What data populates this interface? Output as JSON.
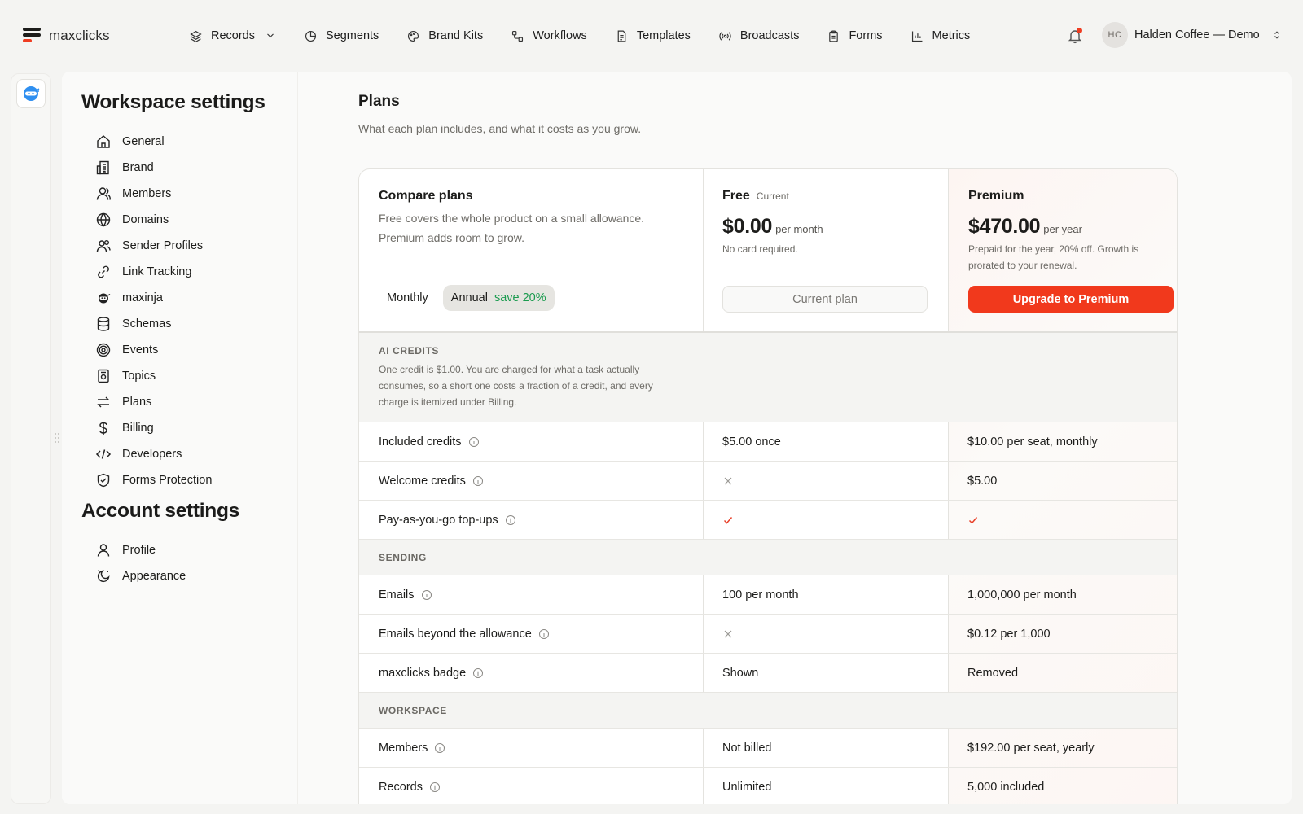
{
  "brand": {
    "name": "maxclicks",
    "colors": {
      "accent": "#f1391c",
      "save_green": "#1b9b4f",
      "logo_dark": "#1d1d1b"
    }
  },
  "nav": {
    "items": [
      {
        "label": "Records",
        "icon": "layers-icon"
      },
      {
        "label": "Segments",
        "icon": "pie-icon"
      },
      {
        "label": "Brand Kits",
        "icon": "palette-icon"
      },
      {
        "label": "Workflows",
        "icon": "workflow-icon"
      },
      {
        "label": "Templates",
        "icon": "document-icon"
      },
      {
        "label": "Broadcasts",
        "icon": "broadcast-icon"
      },
      {
        "label": "Forms",
        "icon": "clipboard-icon"
      },
      {
        "label": "Metrics",
        "icon": "bar-chart-icon"
      }
    ],
    "account": {
      "initials": "HC",
      "name": "Halden Coffee — Demo"
    }
  },
  "workspace_settings": {
    "title": "Workspace settings",
    "items": [
      {
        "label": "General",
        "icon": "home-icon"
      },
      {
        "label": "Brand",
        "icon": "building-icon"
      },
      {
        "label": "Members",
        "icon": "user-icon"
      },
      {
        "label": "Domains",
        "icon": "globe-icon"
      },
      {
        "label": "Sender Profiles",
        "icon": "users-icon"
      },
      {
        "label": "Link Tracking",
        "icon": "link-icon"
      },
      {
        "label": "maxinja",
        "icon": "ninja-icon"
      },
      {
        "label": "Schemas",
        "icon": "database-icon"
      },
      {
        "label": "Events",
        "icon": "target-icon"
      },
      {
        "label": "Topics",
        "icon": "topic-icon"
      },
      {
        "label": "Plans",
        "icon": "swap-icon"
      },
      {
        "label": "Billing",
        "icon": "dollar-icon"
      },
      {
        "label": "Developers",
        "icon": "code-icon"
      },
      {
        "label": "Forms Protection",
        "icon": "shield-icon"
      }
    ]
  },
  "account_settings": {
    "title": "Account settings",
    "items": [
      {
        "label": "Profile",
        "icon": "user-icon"
      },
      {
        "label": "Appearance",
        "icon": "moon-icon"
      }
    ]
  },
  "page": {
    "title": "Plans",
    "subtitle": "What each plan includes, and what it costs as you grow."
  },
  "compare": {
    "title": "Compare plans",
    "description": "Free covers the whole product on a small allowance. Premium adds room to grow.",
    "toggle": {
      "monthly": "Monthly",
      "annual": "Annual",
      "save": "save 20%",
      "selected": "Annual"
    }
  },
  "plans": {
    "free": {
      "name": "Free",
      "badge": "Current",
      "price": "$0.00",
      "per": "per month",
      "note": "No card required.",
      "button": "Current plan"
    },
    "premium": {
      "name": "Premium",
      "price": "$470.00",
      "per": "per year",
      "note": "Prepaid for the year, 20% off. Growth is prorated to your renewal.",
      "button": "Upgrade to Premium"
    }
  },
  "ai_credits": {
    "label": "AI CREDITS",
    "description": "One credit is $1.00. You are charged for what a task actually consumes, so a short one costs a fraction of a credit, and every charge is itemized under Billing."
  },
  "rows": [
    {
      "feature": "Included credits",
      "free": "$5.00 once",
      "premium": "$10.00 per seat, monthly"
    },
    {
      "feature": "Welcome credits",
      "free": "✕",
      "premium": "$5.00"
    },
    {
      "feature": "Pay-as-you-go top-ups",
      "free": "✓",
      "premium": "✓"
    }
  ],
  "sending": {
    "label": "SENDING",
    "rows": [
      {
        "feature": "Emails",
        "free": "100 per month",
        "premium": "1,000,000 per month"
      },
      {
        "feature": "Emails beyond the allowance",
        "free": "✕",
        "premium": "$0.12 per 1,000"
      },
      {
        "feature": "maxclicks badge",
        "free": "Shown",
        "premium": "Removed"
      }
    ]
  },
  "workspace": {
    "label": "WORKSPACE",
    "rows": [
      {
        "feature": "Members",
        "free": "Not billed",
        "premium": "$192.00 per seat, yearly"
      },
      {
        "feature": "Records",
        "free": "Unlimited",
        "premium": "5,000 included"
      }
    ]
  }
}
